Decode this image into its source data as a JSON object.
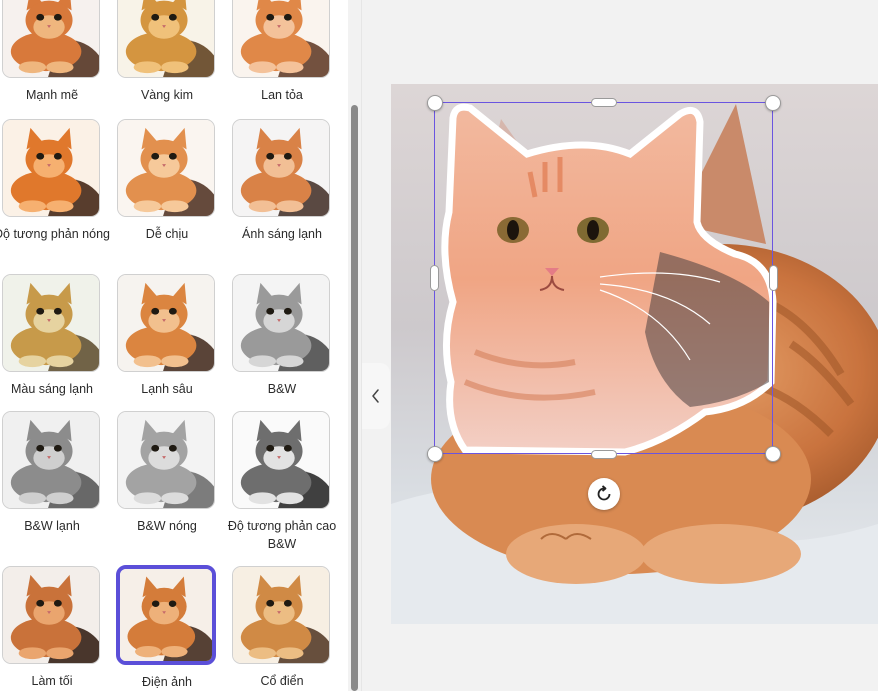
{
  "filters": {
    "items": [
      {
        "label": "Mạnh mẽ",
        "tone": "strong"
      },
      {
        "label": "Vàng kim",
        "tone": "golden"
      },
      {
        "label": "Lan tỏa",
        "tone": "radiant"
      },
      {
        "label": "Độ tương phản nóng",
        "tone": "warm-contrast"
      },
      {
        "label": "Dễ chịu",
        "tone": "pleasant"
      },
      {
        "label": "Ánh sáng lạnh",
        "tone": "cool-light"
      },
      {
        "label": "Màu sáng lạnh",
        "tone": "cool-bright"
      },
      {
        "label": "Lạnh sâu",
        "tone": "deep-cool"
      },
      {
        "label": "B&W",
        "tone": "bw"
      },
      {
        "label": "B&W lạnh",
        "tone": "bw-cool"
      },
      {
        "label": "B&W nóng",
        "tone": "bw-warm"
      },
      {
        "label": "Độ tương phản cao B&W",
        "tone": "bw-high-contrast"
      },
      {
        "label": "Làm tối",
        "tone": "darken"
      },
      {
        "label": "Điện ảnh",
        "tone": "cinematic"
      },
      {
        "label": "Cổ điển",
        "tone": "classic"
      }
    ],
    "selected": "Điện ảnh"
  },
  "icons": {
    "collapse": "chevron-left-icon",
    "rotate": "rotate-icon"
  },
  "colors": {
    "accent": "#5b4fd8",
    "selection_border": "#6a55e0",
    "cat_fur": "#e0894c"
  }
}
